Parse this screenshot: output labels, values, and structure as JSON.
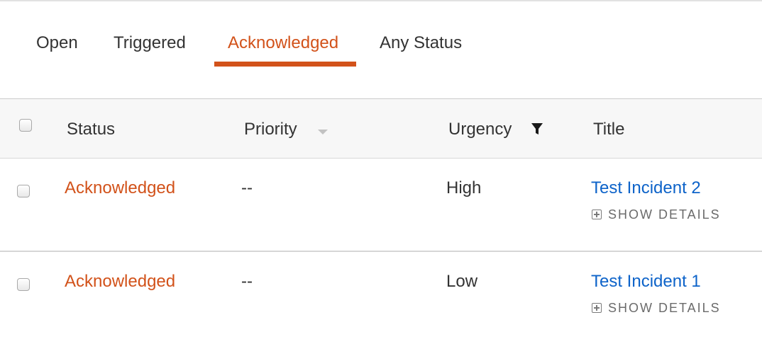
{
  "tabs": [
    {
      "label": "Open",
      "active": false
    },
    {
      "label": "Triggered",
      "active": false
    },
    {
      "label": "Acknowledged",
      "active": true
    },
    {
      "label": "Any Status",
      "active": false
    }
  ],
  "table": {
    "columns": {
      "status": "Status",
      "priority": "Priority",
      "urgency": "Urgency",
      "title": "Title"
    },
    "rows": [
      {
        "status": "Acknowledged",
        "priority": "--",
        "urgency": "High",
        "title": "Test Incident 2",
        "details_label": "SHOW DETAILS"
      },
      {
        "status": "Acknowledged",
        "priority": "--",
        "urgency": "Low",
        "title": "Test Incident 1",
        "details_label": "SHOW DETAILS"
      }
    ]
  },
  "icons": {
    "sort": "sort-down-icon",
    "filter": "filter-icon",
    "expand": "plus-square-icon"
  },
  "colors": {
    "accent": "#d2521a",
    "link": "#0d63c9",
    "header_bg": "#f7f7f7"
  }
}
